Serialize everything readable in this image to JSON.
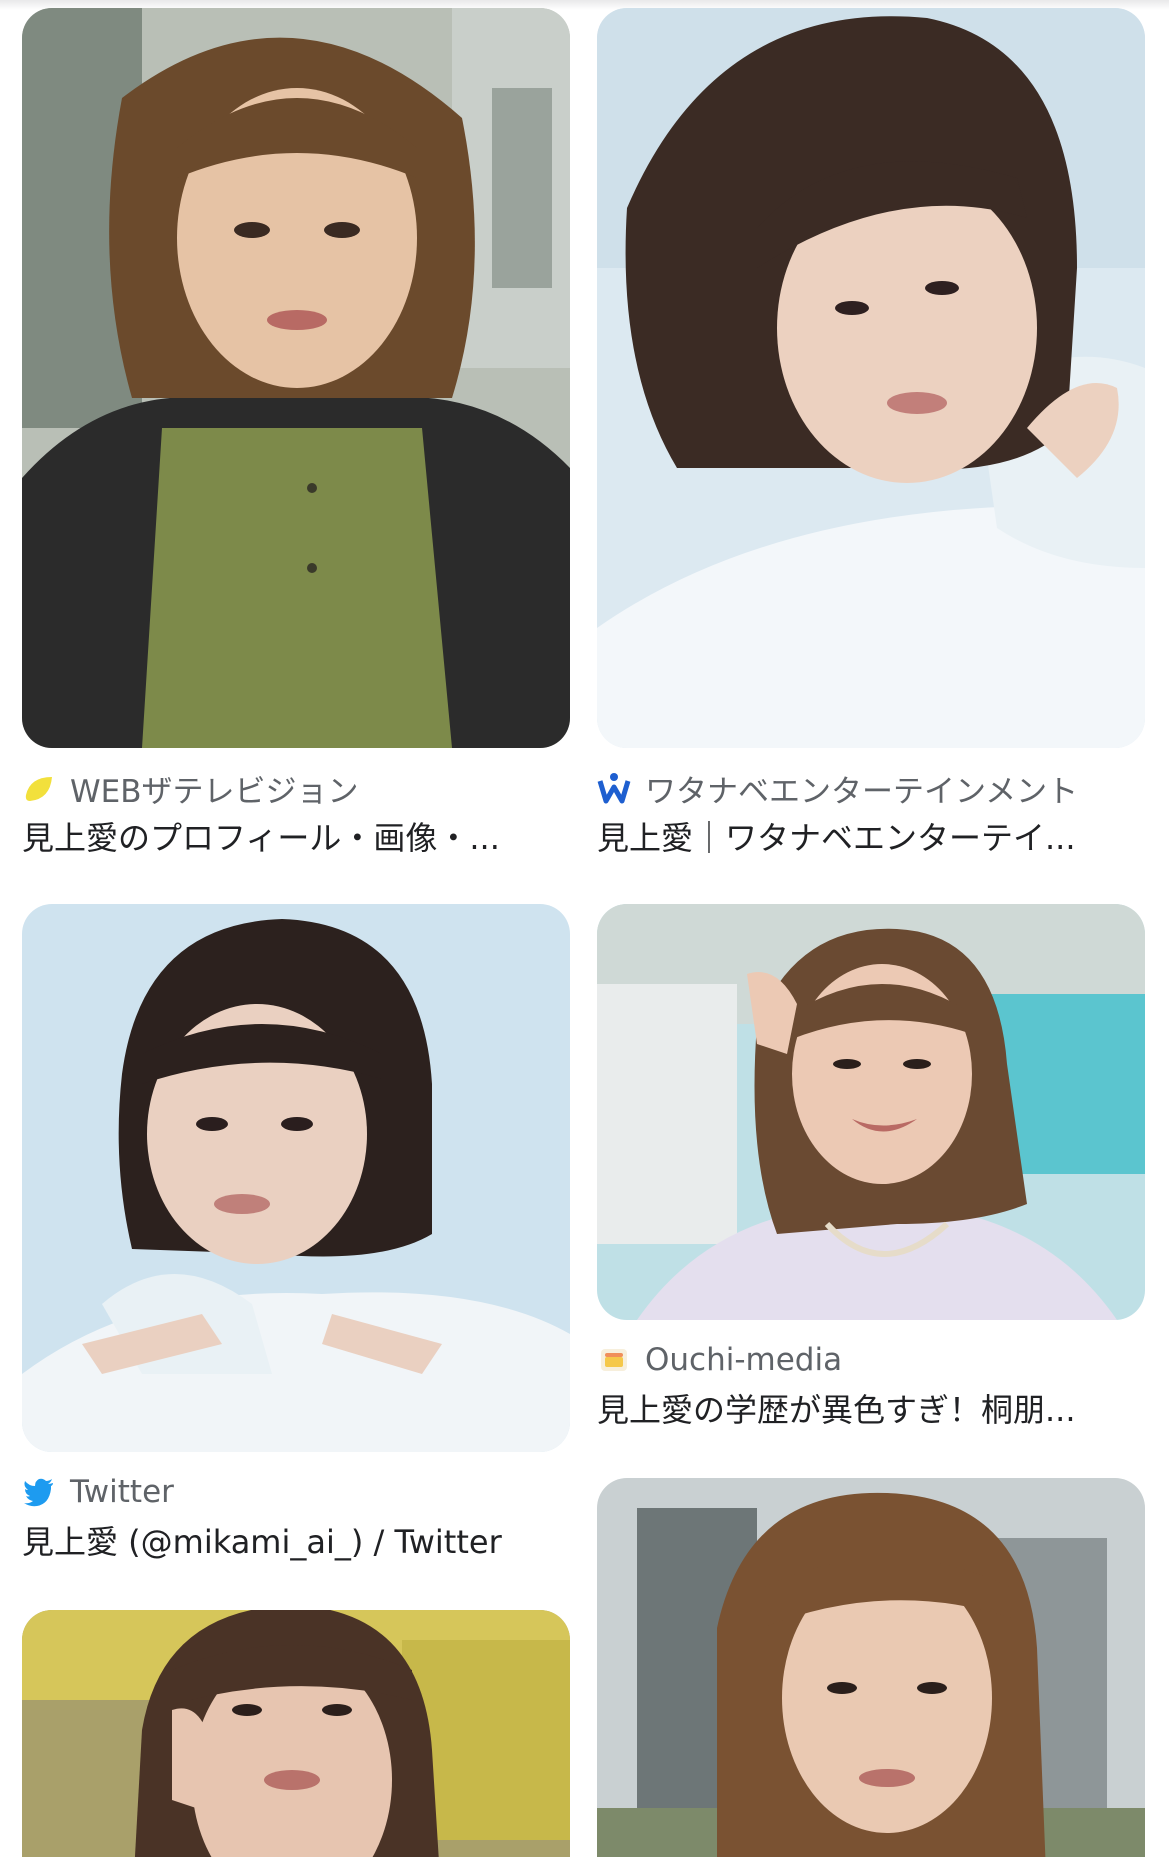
{
  "results": [
    {
      "source": "WEBザテレビジョン",
      "favicon": "lemon-icon",
      "title": "見上愛のプロフィール・画像・..."
    },
    {
      "source": "ワタナベエンターテインメント",
      "favicon": "watanabe-logo-icon",
      "title": "見上愛｜ワタナベエンターテイ..."
    },
    {
      "source": "Twitter",
      "favicon": "twitter-bird-icon",
      "title": "見上愛 (@mikami_ai_) / Twitter"
    },
    {
      "source": "Ouchi-media",
      "favicon": "ouchi-media-icon",
      "title": "見上愛の学歴が異色すぎ！桐朋..."
    }
  ],
  "colors": {
    "twitter_blue": "#1d9bf0",
    "lemon_yellow": "#f2e03c",
    "watanabe_blue": "#1e5fd0",
    "source_text": "#5f6368",
    "title_text": "#202124"
  }
}
